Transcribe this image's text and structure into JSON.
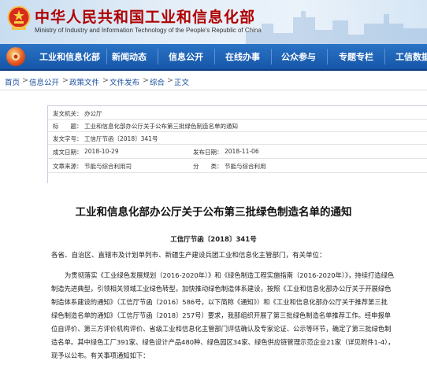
{
  "header": {
    "title": "中华人民共和国工业和信息化部",
    "subtitle": "Ministry of Industry and Information Technology of the People's Republic of China",
    "colors": {
      "title": "#b00000",
      "nav": "#1656a8"
    }
  },
  "nav": {
    "home_icon": "national-emblem-home-icon",
    "items": [
      "工业和信息化部",
      "新闻动态",
      "信息公开",
      "在线办事",
      "公众参与",
      "专题专栏",
      "工信数据"
    ]
  },
  "breadcrumb": [
    "首页",
    "信息公开",
    "政策文件",
    "文件发布",
    "综合",
    "正文"
  ],
  "meta": {
    "issuer_label": "发文机关：",
    "issuer": "办公厅",
    "title_label": "标　　题：",
    "title": "工业和信息化部办公厅关于公布第三批绿色制造名单的通知",
    "doc_no_label": "发文字号：",
    "doc_no": "工信厅节函〔2018〕341号",
    "created_label": "成文日期：",
    "created": "2018-10-29",
    "published_label": "发布日期：",
    "published": "2018-11-06",
    "source_label": "文章来源：",
    "source": "节能与综合利用司",
    "topic_label": "分　　类：",
    "topic": "节能与综合利用"
  },
  "article": {
    "title": "工业和信息化部办公厅关于公布第三批绿色制造名单的通知",
    "doc_number": "工信厅节函〔2018〕341号",
    "salutation": "各省、自治区、直辖市及计划单列市、新疆生产建设兵团工业和信息化主管部门，有关单位：",
    "paragraph_lines": [
      "为贯彻落实《工业绿色发展规划（2016-2020年）》和《绿色制造工程实施指南（2016-2020年）》，持续打造绿色",
      "制造先进典型，引领相关领域工业绿色转型，加快推动绿色制造体系建设，按照《工业和信息化部办公厅关于开展绿色",
      "制造体系建设的通知》（工信厅节函〔2016〕586号，以下简称《通知》）和《工业和信息化部办公厅关于推荐第三批",
      "绿色制造名单的通知》（工信厅节函〔2018〕257号）要求，我部组织开展了第三批绿色制造名单推荐工作。经申报单",
      "位自评价、第三方评价机构评价、省级工业和信息化主管部门评估确认及专家论证、公示等环节，确定了第三批绿色制",
      "造名单。其中绿色工厂391家、绿色设计产品480种、绿色园区34家、绿色供应链管理示范企业21家（详见附件1-4），",
      "现予以公布。有关事项通知如下："
    ]
  }
}
